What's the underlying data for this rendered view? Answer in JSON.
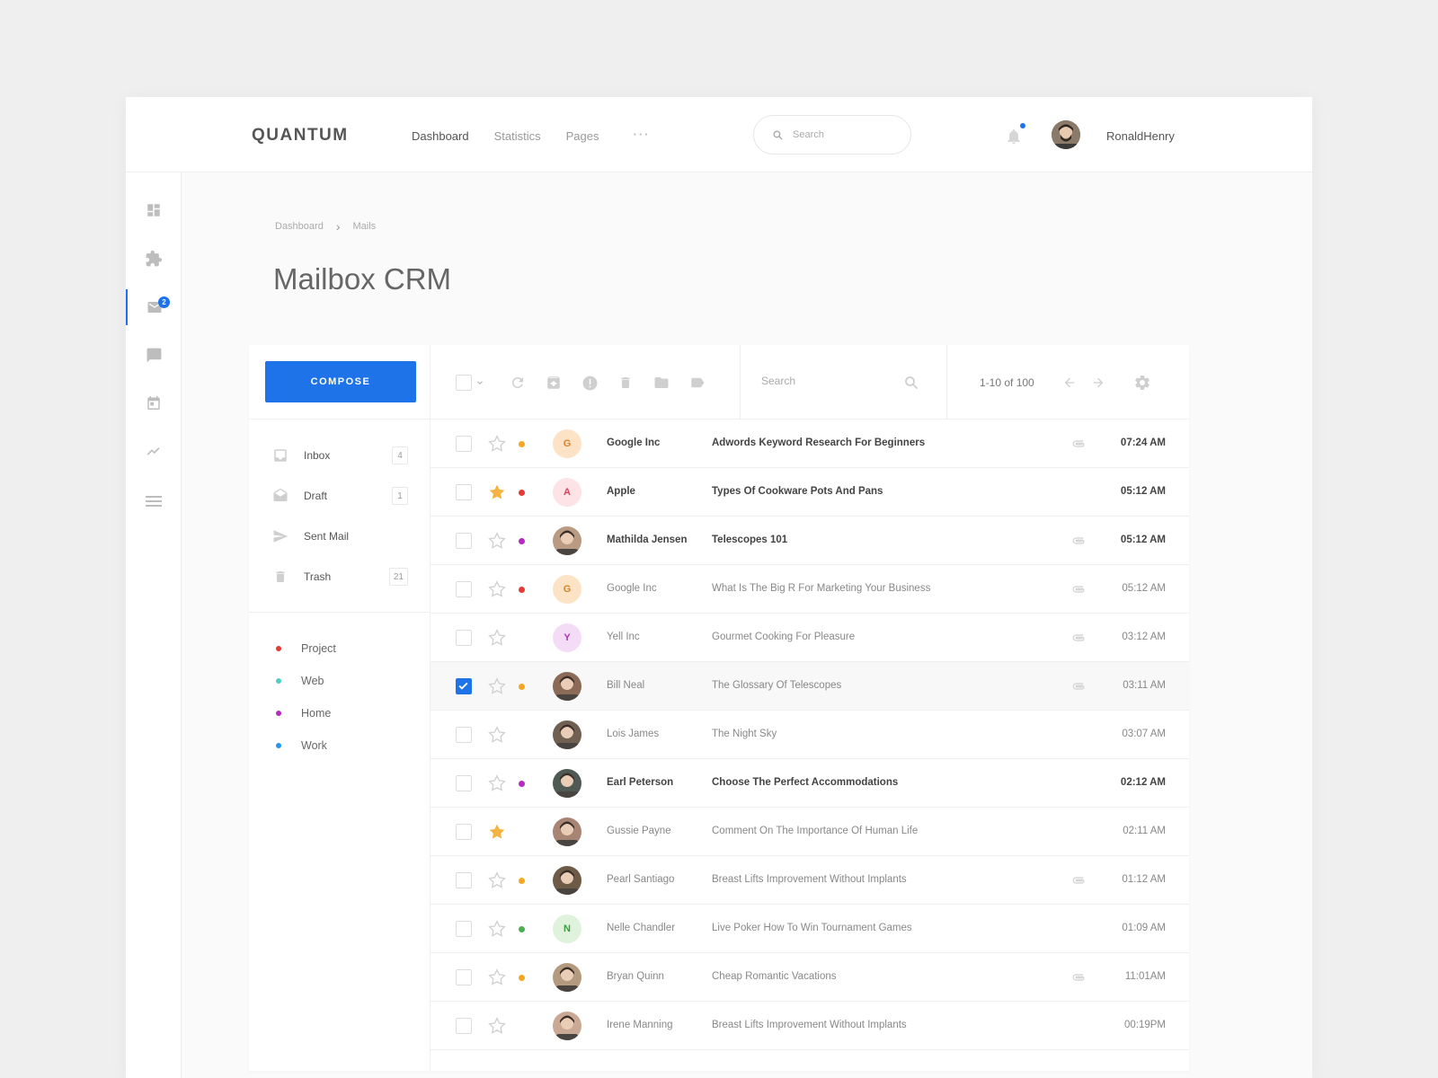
{
  "app": {
    "brand": "QUANTUM",
    "nav": [
      {
        "label": "Dashboard",
        "active": true
      },
      {
        "label": "Statistics",
        "active": false
      },
      {
        "label": "Pages",
        "active": false
      }
    ],
    "nav_more": "···",
    "search_placeholder": "Search",
    "username": "RonaldHenry",
    "accent_color": "#1e73e8"
  },
  "sidebar": {
    "icons": [
      "dashboard-icon",
      "puzzle-icon",
      "mail-icon",
      "chat-icon",
      "calendar-icon",
      "trending-icon",
      "menu-icon"
    ],
    "active": "mail-icon",
    "mail_badge": "2"
  },
  "breadcrumb": {
    "items": [
      "Dashboard",
      "Mails"
    ],
    "separator": "›"
  },
  "page": {
    "title": "Mailbox CRM"
  },
  "mailbox": {
    "compose_label": "COMPOSE",
    "folders": [
      {
        "label": "Inbox",
        "count": "4",
        "icon": "inbox-icon"
      },
      {
        "label": "Draft",
        "count": "1",
        "icon": "draft-icon"
      },
      {
        "label": "Sent Mail",
        "count": "",
        "icon": "send-icon"
      },
      {
        "label": "Trash",
        "count": "21",
        "icon": "trash-icon"
      }
    ],
    "labels": [
      {
        "label": "Project",
        "color": "#e53935"
      },
      {
        "label": "Web",
        "color": "#4dd0c1"
      },
      {
        "label": "Home",
        "color": "#b52ac2"
      },
      {
        "label": "Work",
        "color": "#2196f3"
      }
    ],
    "toolbar": {
      "search_placeholder": "Search",
      "pager": "1-10 of 100",
      "icons": [
        "select-all-checkbox",
        "chevron-down-icon",
        "refresh-icon",
        "archive-icon",
        "report-spam-icon",
        "delete-icon",
        "folder-icon",
        "label-icon",
        "search-icon",
        "arrow-left-icon",
        "arrow-right-icon",
        "settings-icon"
      ]
    },
    "mails": [
      {
        "sender": "Google Inc",
        "subject": "Adwords Keyword Research For Beginners",
        "time": "07:24 AM",
        "starred": false,
        "dot": "#f5a623",
        "attachment": true,
        "unread": true,
        "checked": false,
        "avatar_letter": "G",
        "avatar_bg": "#fde3c6",
        "avatar_fg": "#d9822b"
      },
      {
        "sender": "Apple",
        "subject": "Types Of Cookware Pots And Pans",
        "time": "05:12 AM",
        "starred": true,
        "dot": "#e53935",
        "attachment": false,
        "unread": true,
        "checked": false,
        "avatar_letter": "A",
        "avatar_bg": "#fde2e6",
        "avatar_fg": "#d6415a"
      },
      {
        "sender": "Mathilda Jensen",
        "subject": "Telescopes 101",
        "time": "05:12 AM",
        "starred": false,
        "dot": "#b52ac2",
        "attachment": true,
        "unread": true,
        "checked": false,
        "avatar_letter": "",
        "avatar_bg": "#b99a83",
        "avatar_fg": "#fff"
      },
      {
        "sender": "Google Inc",
        "subject": "What Is The Big R For Marketing Your Business",
        "time": "05:12 AM",
        "starred": false,
        "dot": "#e53935",
        "attachment": true,
        "unread": false,
        "checked": false,
        "avatar_letter": "G",
        "avatar_bg": "#fde3c6",
        "avatar_fg": "#d9822b"
      },
      {
        "sender": "Yell Inc",
        "subject": "Gourmet Cooking For Pleasure",
        "time": "03:12 AM",
        "starred": false,
        "dot": "",
        "attachment": true,
        "unread": false,
        "checked": false,
        "avatar_letter": "Y",
        "avatar_bg": "#f5dcf6",
        "avatar_fg": "#a83bb0"
      },
      {
        "sender": "Bill Neal",
        "subject": "The Glossary Of Telescopes",
        "time": "03:11 AM",
        "starred": false,
        "dot": "#f5a623",
        "attachment": true,
        "unread": false,
        "checked": true,
        "avatar_letter": "",
        "avatar_bg": "#8b6b58",
        "avatar_fg": "#fff"
      },
      {
        "sender": "Lois James",
        "subject": "The Night Sky",
        "time": "03:07 AM",
        "starred": false,
        "dot": "",
        "attachment": false,
        "unread": false,
        "checked": false,
        "avatar_letter": "",
        "avatar_bg": "#6f6052",
        "avatar_fg": "#fff"
      },
      {
        "sender": "Earl Peterson",
        "subject": "Choose The Perfect Accommodations",
        "time": "02:12 AM",
        "starred": false,
        "dot": "#b52ac2",
        "attachment": false,
        "unread": true,
        "checked": false,
        "avatar_letter": "",
        "avatar_bg": "#4f5a55",
        "avatar_fg": "#fff"
      },
      {
        "sender": "Gussie Payne",
        "subject": "Comment On The Importance Of Human Life",
        "time": "02:11 AM",
        "starred": true,
        "dot": "",
        "attachment": false,
        "unread": false,
        "checked": false,
        "avatar_letter": "",
        "avatar_bg": "#a88474",
        "avatar_fg": "#fff"
      },
      {
        "sender": "Pearl Santiago",
        "subject": "Breast Lifts Improvement Without Implants",
        "time": "01:12 AM",
        "starred": false,
        "dot": "#f5a623",
        "attachment": true,
        "unread": false,
        "checked": false,
        "avatar_letter": "",
        "avatar_bg": "#6e5b47",
        "avatar_fg": "#fff"
      },
      {
        "sender": "Nelle Chandler",
        "subject": "Live Poker How To Win Tournament Games",
        "time": "01:09 AM",
        "starred": false,
        "dot": "#4caf50",
        "attachment": false,
        "unread": false,
        "checked": false,
        "avatar_letter": "N",
        "avatar_bg": "#dff3dc",
        "avatar_fg": "#3d9a41"
      },
      {
        "sender": "Bryan Quinn",
        "subject": "Cheap Romantic Vacations",
        "time": "11:01AM",
        "starred": false,
        "dot": "#f5a623",
        "attachment": true,
        "unread": false,
        "checked": false,
        "avatar_letter": "",
        "avatar_bg": "#b49a7e",
        "avatar_fg": "#fff"
      },
      {
        "sender": "Irene Manning",
        "subject": "Breast Lifts Improvement Without Implants",
        "time": "00:19PM",
        "starred": false,
        "dot": "",
        "attachment": false,
        "unread": false,
        "checked": false,
        "avatar_letter": "",
        "avatar_bg": "#c9a995",
        "avatar_fg": "#fff"
      }
    ]
  }
}
